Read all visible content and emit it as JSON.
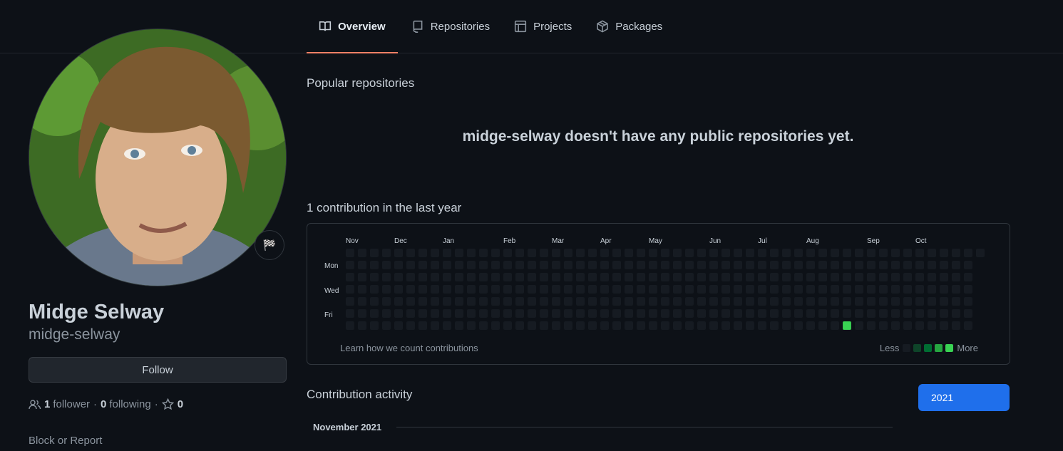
{
  "tabs": [
    {
      "label": "Overview",
      "icon": "book-icon",
      "active": true
    },
    {
      "label": "Repositories",
      "icon": "repo-icon",
      "active": false
    },
    {
      "label": "Projects",
      "icon": "project-icon",
      "active": false
    },
    {
      "label": "Packages",
      "icon": "package-icon",
      "active": false
    }
  ],
  "profile": {
    "name": "Midge Selway",
    "login": "midge-selway",
    "status_icon": "flag-icon",
    "follow_label": "Follow",
    "followers_count": "1",
    "followers_label": "follower",
    "following_count": "0",
    "following_label": "following",
    "stars_count": "0",
    "block_label": "Block or Report"
  },
  "popular": {
    "title": "Popular repositories",
    "empty_message": "midge-selway doesn't have any public repositories yet."
  },
  "contributions": {
    "title": "1 contribution in the last year",
    "months": [
      "Nov",
      "Dec",
      "Jan",
      "Feb",
      "Mar",
      "Apr",
      "May",
      "Jun",
      "Jul",
      "Aug",
      "Sep",
      "Oct"
    ],
    "days": [
      "Mon",
      "Wed",
      "Fri"
    ],
    "weeks": 53,
    "last_week_days": 1,
    "highlight": {
      "week": 41,
      "day": 6,
      "level": 4
    },
    "learn_label": "Learn how we count contributions",
    "legend_less": "Less",
    "legend_more": "More",
    "colors": [
      "#161b22",
      "#0e4429",
      "#006d32",
      "#26a641",
      "#39d353"
    ]
  },
  "activity": {
    "title": "Contribution activity",
    "year": "2021",
    "month_heading": "November 2021"
  }
}
